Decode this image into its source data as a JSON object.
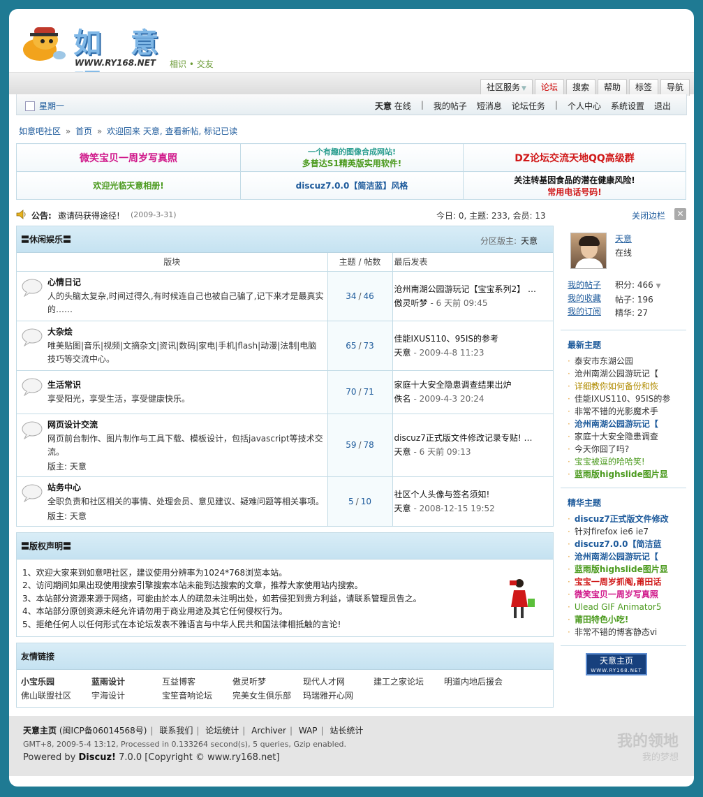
{
  "logo": {
    "title": "如 意 吧",
    "url": "WWW.RY168.NET",
    "slogan": "相识 • 交友"
  },
  "menu": [
    {
      "label": "社区服务",
      "active": false
    },
    {
      "label": "论坛",
      "active": true
    },
    {
      "label": "搜索",
      "active": false
    },
    {
      "label": "帮助",
      "active": false
    },
    {
      "label": "标签",
      "active": false
    },
    {
      "label": "导航",
      "active": false
    }
  ],
  "userbar": {
    "day": "星期一",
    "username": "天意",
    "online": "在线",
    "links": [
      "我的帖子",
      "短消息",
      "论坛任务",
      "个人中心",
      "系统设置",
      "退出"
    ]
  },
  "breadcrumb": {
    "site": "如意吧社区",
    "home": "首页",
    "welcome": "欢迎回来 天意, 查看新帖, 标记已读"
  },
  "ads": {
    "r1c1": "微笑宝贝一周岁写真照",
    "r1c2a": "一个有趣的图像合成网站!",
    "r1c2b": "多普达S1精英版实用软件!",
    "r1c3": "DZ论坛交流天地QQ高级群",
    "r2c1": "欢迎光临天意相册!",
    "r2c2": "discuz7.0.0【简洁蓝】风格",
    "r2c3a": "关注转基因食品的潜在健康风险!",
    "r2c3b": "常用电话号码!"
  },
  "notice": {
    "label": "公告:",
    "text": "邀请码获得途径!",
    "date": "(2009-3-31)",
    "stats": "今日: 0, 主题: 233, 会员: 13",
    "close": "关闭边栏"
  },
  "category": {
    "title": "〓休闲娱乐〓",
    "mod_label": "分区版主:",
    "mod_name": "天意",
    "col_forum": "版块",
    "col_count": "主题 / 帖数",
    "col_last": "最后发表"
  },
  "forums": [
    {
      "name": "心情日记",
      "desc": "人的头脑太复杂,时间过得久,有时候连自己也被自己骗了,记下来才是最真实的……",
      "mod": "",
      "topics": "34",
      "posts": "46",
      "last_title": "沧州南湖公园游玩记【宝宝系列2】 …",
      "last_by": "傲灵听梦",
      "last_time": "- 6 天前 09:45"
    },
    {
      "name": "大杂烩",
      "desc": "唯美贴图|音乐|视频|文摘杂文|资讯|数码|家电|手机|flash|动漫|法制|电脑技巧等交流中心。",
      "mod": "",
      "topics": "65",
      "posts": "73",
      "last_title": "佳能IXUS110、95IS的参考",
      "last_by": "天意",
      "last_time": "- 2009-4-8 11:23"
    },
    {
      "name": "生活常识",
      "desc": "享受阳光，享受生活，享受健康快乐。",
      "mod": "",
      "topics": "70",
      "posts": "71",
      "last_title": "家庭十大安全隐患调查结果出炉",
      "last_by": "佚名",
      "last_time": "- 2009-4-3 20:24"
    },
    {
      "name": "网页设计交流",
      "desc": "网页前台制作、图片制作与工具下载、模板设计，包括javascript等技术交流。",
      "mod": "版主: 天意",
      "topics": "59",
      "posts": "78",
      "last_title": "discuz7正式版文件修改记录专贴! …",
      "last_by": "天意",
      "last_time": "- 6 天前 09:13"
    },
    {
      "name": "站务中心",
      "desc": "全职负责和社区相关的事情、处理会员、意见建议、疑难问题等相关事项。",
      "mod": "版主: 天意",
      "topics": "5",
      "posts": "10",
      "last_title": "社区个人头像与签名须知!",
      "last_by": "天意",
      "last_time": "- 2008-12-15 19:52"
    }
  ],
  "copyright": {
    "title": "〓版权声明〓",
    "lines": [
      "1、欢迎大家来到如意吧社区，建议使用分辨率为1024*768浏览本站。",
      "2、访问期间如果出现使用搜索引擎搜索本站未能到达搜索的文章，推荐大家使用站内搜索。",
      "3、本站部分资源来源于网络，可能由於本人的疏忽未注明出处，如若侵犯到贵方利益，请联系管理员告之。",
      "4、本站部分原创资源未经允许请勿用于商业用途及其它任何侵权行为。",
      "5、拒绝任何人以任何形式在本论坛发表不雅语言与中华人民共和国法律相抵触的言论!"
    ]
  },
  "friendlinks": {
    "title": "友情链接",
    "items": [
      "小宝乐园",
      "蓝雨设计",
      "互益博客",
      "傲灵听梦",
      "现代人才网",
      "建工之家论坛",
      "明道内地后援会",
      "佛山联盟社区",
      "宇海设计",
      "宝笙音响论坛",
      "完美女生俱乐部",
      "玛瑞雅开心网"
    ]
  },
  "profile": {
    "name": "天意",
    "status": "在线",
    "links": [
      "我的帖子",
      "我的收藏",
      "我的订阅"
    ],
    "stats": [
      "积分: 466",
      "帖子: 196",
      "精华: 27"
    ]
  },
  "latest": {
    "title": "最新主题",
    "items": [
      {
        "text": "泰安市东湖公园",
        "style": "c-norm"
      },
      {
        "text": "沧州南湖公园游玩记【",
        "style": "c-norm"
      },
      {
        "text": "详细教你如何备份和恢",
        "style": "c-olive"
      },
      {
        "text": "佳能IXUS110、95IS的参",
        "style": "c-norm"
      },
      {
        "text": "非常不错的光影魔术手",
        "style": "c-norm"
      },
      {
        "text": "沧州南湖公园游玩记【",
        "style": "c-blue"
      },
      {
        "text": "家庭十大安全隐患调查",
        "style": "c-norm"
      },
      {
        "text": "今天你囧了吗?",
        "style": "c-norm"
      },
      {
        "text": "宝宝被逗的哈哈笑!",
        "style": "c-greenn"
      },
      {
        "text": "蓝雨版highslide图片显",
        "style": "c-green"
      }
    ]
  },
  "digest": {
    "title": "精华主题",
    "items": [
      {
        "text": "discuz7正式版文件修改",
        "style": "c-blue"
      },
      {
        "text": "针对firefox ie6 ie7",
        "style": "c-norm"
      },
      {
        "text": "discuz7.0.0【简洁蓝",
        "style": "c-blue"
      },
      {
        "text": "沧州南湖公园游玩记【",
        "style": "c-blue"
      },
      {
        "text": "蓝雨版highslide图片显",
        "style": "c-green"
      },
      {
        "text": "宝宝一周岁抓阄,莆田话",
        "style": "c-red"
      },
      {
        "text": "微笑宝贝一周岁写真照",
        "style": "c-pink"
      },
      {
        "text": "Ulead GIF Animator5",
        "style": "c-greenn"
      },
      {
        "text": "莆田特色小吃!",
        "style": "c-green"
      },
      {
        "text": "非常不错的博客静态vi",
        "style": "c-norm"
      }
    ]
  },
  "sidelogo": {
    "title": "天意主页",
    "url": "WWW.RY168.NET"
  },
  "footer": {
    "site": "天意主页",
    "icp": "(闽ICP备06014568号)",
    "links": [
      "联系我们",
      "论坛统计",
      "Archiver",
      "WAP",
      "站长统计"
    ],
    "tech": "GMT+8, 2009-5-4 13:12, Processed in 0.133264 second(s), 5 queries, Gzip enabled.",
    "powered_prefix": "Powered by",
    "powered_brand": "Discuz!",
    "powered_suffix": "7.0.0 [Copyright © www.ry168.net]",
    "watermark1": "我的领地",
    "watermark2": "我的梦想"
  },
  "colors": {
    "page_bg": "#1f7a93",
    "accent": "#1d5a9b",
    "border": "#c3dbe6"
  }
}
